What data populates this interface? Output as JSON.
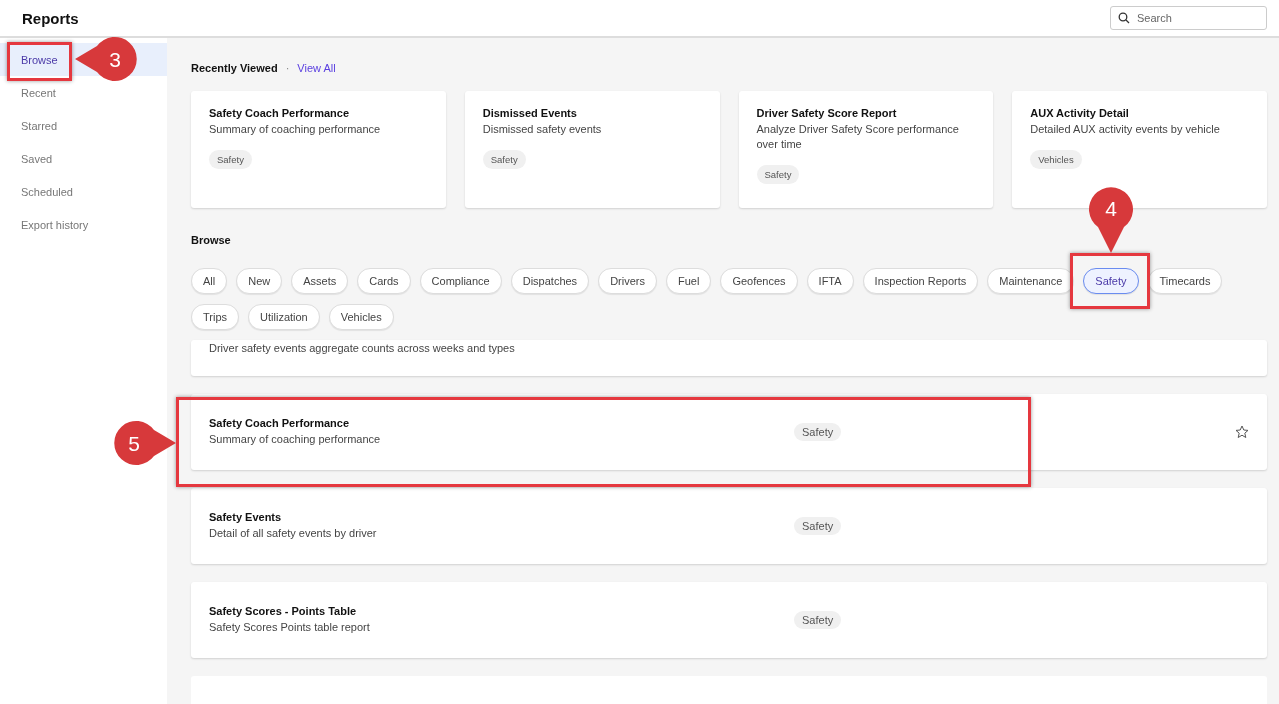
{
  "header": {
    "title": "Reports",
    "search": {
      "placeholder": "Search"
    }
  },
  "sidebar": {
    "items": [
      {
        "label": "Browse",
        "selected": true
      },
      {
        "label": "Recent",
        "selected": false
      },
      {
        "label": "Starred",
        "selected": false
      },
      {
        "label": "Saved",
        "selected": false
      },
      {
        "label": "Scheduled",
        "selected": false
      },
      {
        "label": "Export history",
        "selected": false
      }
    ]
  },
  "recently_viewed": {
    "title": "Recently Viewed",
    "separator": "·",
    "link": "View All",
    "cards": [
      {
        "title": "Safety Coach Performance",
        "description": "Summary of coaching performance",
        "tag": "Safety"
      },
      {
        "title": "Dismissed Events",
        "description": "Dismissed safety events",
        "tag": "Safety"
      },
      {
        "title": "Driver Safety Score Report",
        "description": "Analyze Driver Safety Score performance over time",
        "tag": "Safety"
      },
      {
        "title": "AUX Activity Detail",
        "description": "Detailed AUX activity events by vehicle",
        "tag": "Vehicles"
      }
    ]
  },
  "browse": {
    "title": "Browse",
    "filters": [
      {
        "label": "All",
        "selected": false
      },
      {
        "label": "New",
        "selected": false
      },
      {
        "label": "Assets",
        "selected": false
      },
      {
        "label": "Cards",
        "selected": false
      },
      {
        "label": "Compliance",
        "selected": false
      },
      {
        "label": "Dispatches",
        "selected": false
      },
      {
        "label": "Drivers",
        "selected": false
      },
      {
        "label": "Fuel",
        "selected": false
      },
      {
        "label": "Geofences",
        "selected": false
      },
      {
        "label": "IFTA",
        "selected": false
      },
      {
        "label": "Inspection Reports",
        "selected": false
      },
      {
        "label": "Maintenance",
        "selected": false
      },
      {
        "label": "Safety",
        "selected": true
      },
      {
        "label": "Timecards",
        "selected": false
      },
      {
        "label": "Trips",
        "selected": false
      },
      {
        "label": "Utilization",
        "selected": false
      },
      {
        "label": "Vehicles",
        "selected": false
      }
    ],
    "partial_row": {
      "description": "Driver safety events aggregate counts across weeks and types"
    },
    "reports": [
      {
        "title": "Safety Coach Performance",
        "description": "Summary of coaching performance",
        "tag": "Safety",
        "starred": false
      },
      {
        "title": "Safety Events",
        "description": "Detail of all safety events by driver",
        "tag": "Safety"
      },
      {
        "title": "Safety Scores - Points Table",
        "description": "Safety Scores Points table report",
        "tag": "Safety"
      }
    ]
  },
  "callouts": [
    {
      "number": "3"
    },
    {
      "number": "4"
    },
    {
      "number": "5"
    }
  ]
}
